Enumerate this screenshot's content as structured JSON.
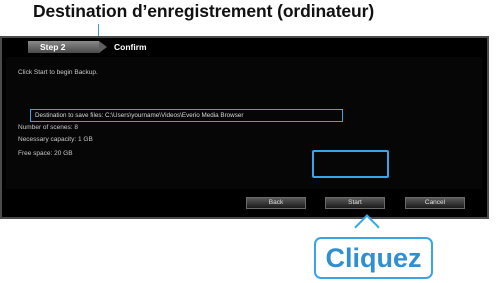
{
  "annotations": {
    "top_caption": "Destination d’enregistrement (ordinateur)",
    "click_caption": "Cliquez"
  },
  "wizard": {
    "step_label": "Step 2",
    "title": "Confirm",
    "intro": "Click Start to begin Backup.",
    "destination": "Destination to save files: C:\\Users\\yourname\\Videos\\Everio Media Browser",
    "number_of_scenes": "Number of scenes: 8",
    "necessary_capacity": "Necessary capacity: 1 GB",
    "free_space": "Free space: 20 GB"
  },
  "buttons": {
    "back": "Back",
    "start": "Start",
    "cancel": "Cancel"
  },
  "colors": {
    "accent": "#35a6e8",
    "panel_bg": "#000000",
    "text": "#c9c9c9"
  }
}
